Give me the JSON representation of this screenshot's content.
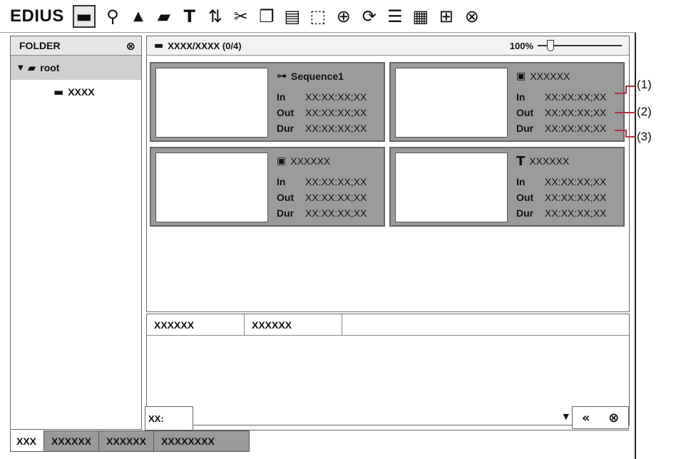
{
  "app": {
    "brand": "EDIUS"
  },
  "toolbar": {
    "icons": [
      "folder-view-icon",
      "search-icon",
      "up-icon",
      "open-folder-icon",
      "new-sequence-icon",
      "replace-icon",
      "cut-icon",
      "copy-icon",
      "paste-icon",
      "add-to-timeline-icon",
      "add-clip-icon",
      "refresh-icon",
      "list-view-icon",
      "view-mode-icon",
      "tools-icon",
      "close-icon"
    ]
  },
  "folder_panel": {
    "title": "FOLDER",
    "tree": [
      {
        "label": "root",
        "selected": true
      },
      {
        "label": "XXXX",
        "selected": false
      }
    ]
  },
  "bin": {
    "path": "XXXX/XXXX (0/4)",
    "zoom": "100%",
    "zoom_fraction": 0.12,
    "clips": [
      {
        "title": "Sequence1",
        "icon": "sequence-icon",
        "in_label": "In",
        "in": "XX:XX:XX;XX",
        "out_label": "Out",
        "out": "XX:XX:XX;XX",
        "dur_label": "Dur",
        "dur": "XX:XX:XX;XX"
      },
      {
        "title": "XXXXXX",
        "icon": "video-clip-icon",
        "in_label": "In",
        "in": "XX:XX:XX;XX",
        "out_label": "Out",
        "out": "XX:XX:XX;XX",
        "dur_label": "Dur",
        "dur": "XX:XX:XX;XX"
      },
      {
        "title": "XXXXXX",
        "icon": "video-clip-icon",
        "in_label": "In",
        "in": "XX:XX:XX;XX",
        "out_label": "Out",
        "out": "XX:XX:XX;XX",
        "dur_label": "Dur",
        "dur": "XX:XX:XX;XX"
      },
      {
        "title": "XXXXXX",
        "icon": "title-clip-icon",
        "in_label": "In",
        "in": "XX:XX:XX;XX",
        "out_label": "Out",
        "out": "XX:XX:XX;XX",
        "dur_label": "Dur",
        "dur": "XX:XX:XX;XX"
      }
    ]
  },
  "properties": {
    "tabs": [
      "XXXXXX",
      "XXXXXX"
    ]
  },
  "bottom": {
    "field_label": "XX:"
  },
  "tabs": [
    "XXX",
    "XXXXXX",
    "XXXXXX",
    "XXXXXXXX"
  ],
  "callouts": [
    "(1)",
    "(2)",
    "(3)"
  ]
}
